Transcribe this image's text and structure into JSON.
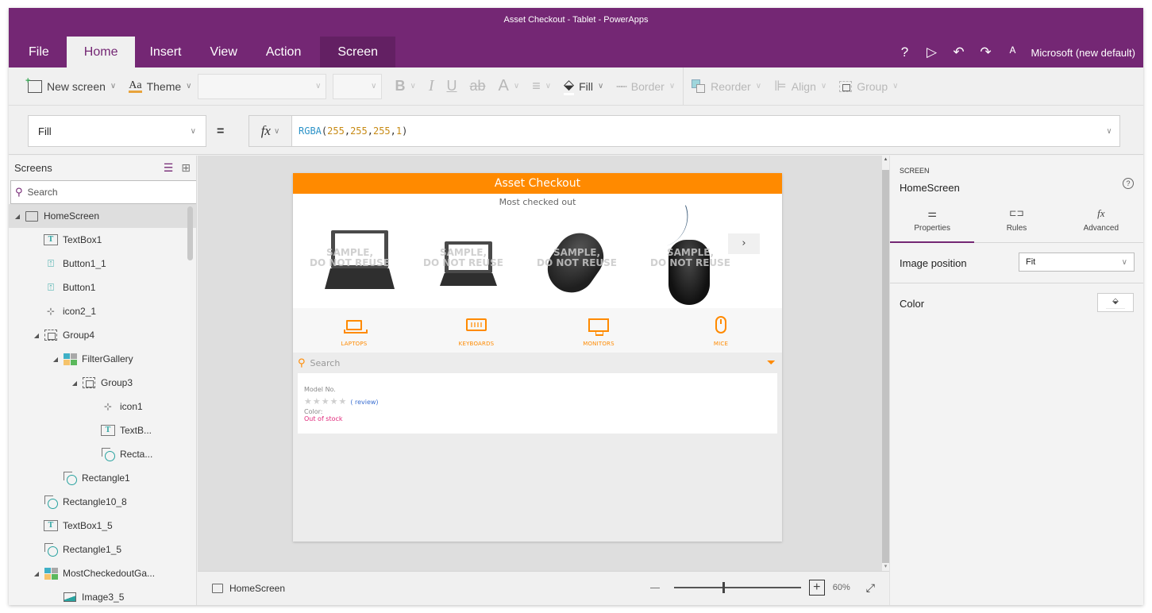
{
  "window": {
    "title": "Asset Checkout - Tablet - PowerApps",
    "tabs": [
      {
        "label": "File"
      },
      {
        "label": "Home",
        "active": true
      },
      {
        "label": "Insert"
      },
      {
        "label": "View"
      },
      {
        "label": "Action"
      },
      {
        "label": "Screen",
        "contextual": true
      }
    ],
    "right_icons": [
      "help-icon",
      "play-icon",
      "undo-icon",
      "redo-icon",
      "user-icon"
    ],
    "environment": "Microsoft (new default)",
    "theme_color": "#742774"
  },
  "toolbar": {
    "new_screen": "New screen",
    "theme": "Theme",
    "theme_glyph": "Aa",
    "font_family_value": "",
    "font_size_value": "",
    "bold": "B",
    "italic": "I",
    "underline": "U",
    "strike": "ab",
    "font_color": "A",
    "align_text": "≡",
    "fill": "Fill",
    "border": "Border",
    "reorder": "Reorder",
    "align": "Align",
    "group": "Group"
  },
  "formula_bar": {
    "property": "Fill",
    "equals": "=",
    "fx": "fx",
    "formula": {
      "fn": "RGBA",
      "open": "(",
      "args": [
        "255",
        "255",
        "255",
        "1"
      ],
      "sep": ",",
      "close": ")"
    }
  },
  "tree": {
    "title": "Screens",
    "search_placeholder": "Search",
    "rows": [
      {
        "label": "HomeScreen",
        "icon": "screen",
        "depth": 0,
        "expander": true,
        "selected": true
      },
      {
        "label": "TextBox1",
        "icon": "text",
        "depth": 1
      },
      {
        "label": "Button1_1",
        "icon": "button",
        "depth": 1
      },
      {
        "label": "Button1",
        "icon": "button",
        "depth": 1
      },
      {
        "label": "icon2_1",
        "icon": "icon",
        "depth": 1
      },
      {
        "label": "Group4",
        "icon": "group",
        "depth": 1,
        "expander": true
      },
      {
        "label": "FilterGallery",
        "icon": "gallery",
        "depth": 2,
        "expander": true
      },
      {
        "label": "Group3",
        "icon": "group",
        "depth": 3,
        "expander": true
      },
      {
        "label": "icon1",
        "icon": "icon",
        "depth": 4
      },
      {
        "label": "TextB...",
        "icon": "text",
        "depth": 4
      },
      {
        "label": "Recta...",
        "icon": "rect",
        "depth": 4
      },
      {
        "label": "Rectangle1",
        "icon": "rect",
        "depth": 2
      },
      {
        "label": "Rectangle10_8",
        "icon": "rect",
        "depth": 1
      },
      {
        "label": "TextBox1_5",
        "icon": "text",
        "depth": 1
      },
      {
        "label": "Rectangle1_5",
        "icon": "rect",
        "depth": 1
      },
      {
        "label": "MostCheckedoutGa...",
        "icon": "gallery",
        "depth": 1,
        "expander": true
      },
      {
        "label": "Image3_5",
        "icon": "image",
        "depth": 2
      }
    ]
  },
  "app": {
    "header": "Asset Checkout",
    "accent": "#ff8a00",
    "most_checked_title": "Most checked out",
    "watermark_line1": "SAMPLE,",
    "watermark_line2": "DO NOT REUSE",
    "products": [
      {
        "kind": "laptop"
      },
      {
        "kind": "laptop-small"
      },
      {
        "kind": "mouse-wireless"
      },
      {
        "kind": "mouse-wired"
      }
    ],
    "next_glyph": "›",
    "categories": [
      {
        "label": "LAPTOPS",
        "icon": "laptop"
      },
      {
        "label": "KEYBOARDS",
        "icon": "keyboard"
      },
      {
        "label": "MONITORS",
        "icon": "monitor"
      },
      {
        "label": "MICE",
        "icon": "mouse"
      }
    ],
    "search_placeholder": "Search",
    "result": {
      "model_label": "Model No.",
      "rating_stars": 0,
      "rating_max": 5,
      "review_link": "( review)",
      "color_label": "Color:",
      "stock_status": "Out of stock",
      "stock_color": "#e0287a"
    }
  },
  "statusbar": {
    "screen_name": "HomeScreen",
    "zoom_percent": "60%",
    "zoom_slider_fraction": 0.38
  },
  "properties_panel": {
    "kind": "SCREEN",
    "name": "HomeScreen",
    "tabs": [
      {
        "label": "Properties",
        "active": true
      },
      {
        "label": "Rules"
      },
      {
        "label": "Advanced"
      }
    ],
    "image_position_label": "Image position",
    "image_position_value": "Fit",
    "color_label": "Color"
  }
}
